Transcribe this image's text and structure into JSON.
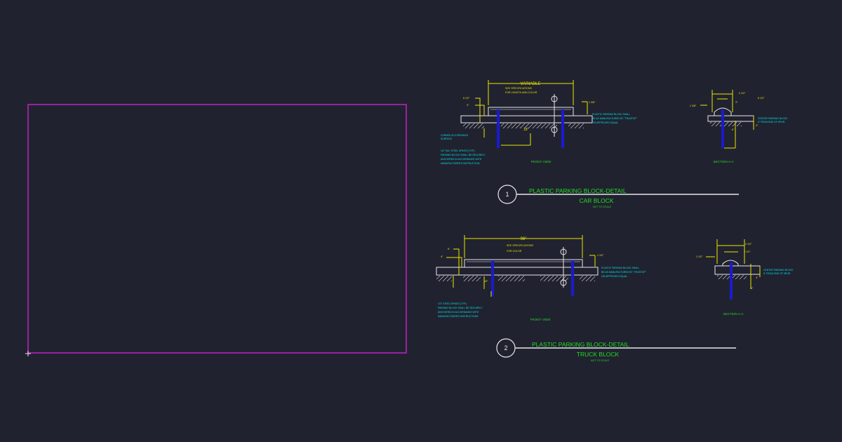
{
  "colors": {
    "background": "#212230",
    "frame": "#cc22cc",
    "line": "#e8e8e8",
    "dimension": "#e6e600",
    "note": "#00e5e5",
    "title": "#22dd22",
    "steel": "#1a1ad0"
  },
  "detail1": {
    "number": "1",
    "title": "PLASTIC PARKING BLOCK-DETAIL",
    "subtitle": "CAR BLOCK",
    "scale": "NOT TO SCALE",
    "front_view_label": "FRONT VIEW",
    "section_label": "SECTION A-A",
    "dim_length": "VARIABLE",
    "spec_note_1": "SEE SPECIFICATIONS",
    "spec_note_2": "FOR LENGTH AND COLOR",
    "dim_height": "6 1/2\"",
    "dim_4": "4\"",
    "dim_18": "18\"",
    "dim_1_3_8": "1 3/8\"",
    "note_block_1": "PLASTIC PARKING BLOCK SHALL",
    "note_block_2": "BE AS MANUFACTURED BY \"TRUSTOP\"",
    "note_block_3": "OR APPROVED EQUAL",
    "note_curb_1": "CURBED ACCORDANCE",
    "note_curb_2": "SURFACE",
    "note_spike_1": "1/2\" DIA. STEEL SPIKES (TYP.)",
    "note_spike_2": "PARKING BLOCK SHALL BE SECURELY",
    "note_spike_3": "ANCHORED IN ACCORDANCE WITH",
    "note_spike_4": "MANUFACTURER'S INSTRUCTION.",
    "sec_dim_a": "2 1/2\"",
    "sec_dim_b": "6 1/2\"",
    "sec_dim_c": "1 3/8\"",
    "sec_dim_d": "3\"",
    "sec_dim_e": "4\"",
    "sec_dim_f": "6\"",
    "sec_note_1": "CENTER PARKING BLOCK",
    "sec_note_2": "6\" FROM END OF SPUR."
  },
  "detail2": {
    "number": "2",
    "title": "PLASTIC PARKING BLOCK-DETAIL",
    "subtitle": "TRUCK BLOCK",
    "scale": "NOT TO SCALE",
    "front_view_label": "FRONT VIEW",
    "section_label": "SECTION A-A",
    "dim_length": "96\"",
    "spec_note_1": "SEE SPECIFICATIONS",
    "spec_note_2": "FOR COLOR",
    "dim_height": "6\"",
    "dim_4": "4\"",
    "dim_18": "18\"",
    "dim_1_3_8": "1 1/2\"",
    "note_block_1": "PLASTIC PARKING BLOCK SHALL",
    "note_block_2": "BE AS MANUFACTURED BY \"TRUSTOP\"",
    "note_block_3": "OR APPROVED EQUAL",
    "note_spike_1": "1/2\" STEEL SPIKES (TYP.)",
    "note_spike_2": "PARKING BLOCK SHALL BE SECURELY",
    "note_spike_3": "ANCHORED IN ACCORDANCE WITH",
    "note_spike_4": "MANUFACTURER'S INSTRUCTIONS",
    "sec_dim_a": "2 1/2\"",
    "sec_dim_b": "2 1/2\"",
    "sec_dim_c": "1 1/2\"",
    "sec_dim_d": "4\"",
    "sec_dim_e": "6\"",
    "sec_note_1": "CENTER PARKING BLOCK",
    "sec_note_2": "6\" FROM END OF SPUR."
  }
}
